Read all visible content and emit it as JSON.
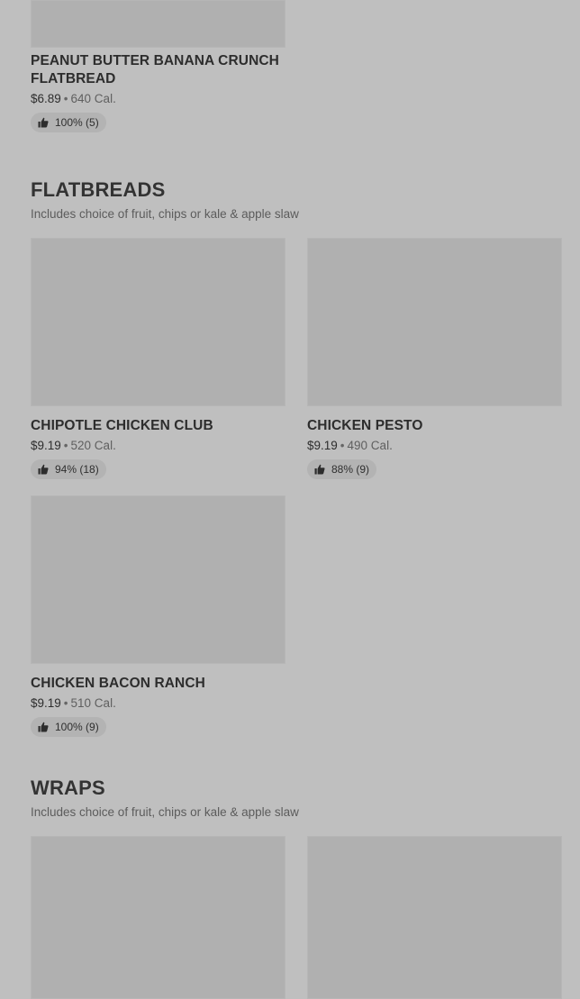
{
  "sections": [
    {
      "title": "",
      "subtitle": "",
      "items": [
        {
          "name": "PEANUT BUTTER BANANA CRUNCH FLATBREAD",
          "price": "$6.89",
          "calories": "640 Cal.",
          "rating": "100% (5)"
        }
      ]
    },
    {
      "title": "FLATBREADS",
      "subtitle": "Includes choice of fruit, chips or kale & apple slaw",
      "items": [
        {
          "name": "CHIPOTLE CHICKEN CLUB",
          "price": "$9.19",
          "calories": "520 Cal.",
          "rating": "94% (18)"
        },
        {
          "name": "CHICKEN PESTO",
          "price": "$9.19",
          "calories": "490 Cal.",
          "rating": "88% (9)"
        },
        {
          "name": "CHICKEN BACON RANCH",
          "price": "$9.19",
          "calories": "510 Cal.",
          "rating": "100% (9)"
        }
      ]
    },
    {
      "title": "WRAPS",
      "subtitle": "Includes choice of fruit, chips or kale & apple slaw",
      "items": [
        {
          "name": "",
          "price": "",
          "calories": "",
          "rating": ""
        },
        {
          "name": "",
          "price": "",
          "calories": "",
          "rating": ""
        }
      ]
    }
  ],
  "meta_separator": "•",
  "icons": {
    "rating": "thumbs-up-icon"
  },
  "colors": {
    "background": "#bfbfbf",
    "image_placeholder": "#b0b0b0",
    "rating_pill": "#b3b3b3",
    "text": "#2f2f2f"
  }
}
